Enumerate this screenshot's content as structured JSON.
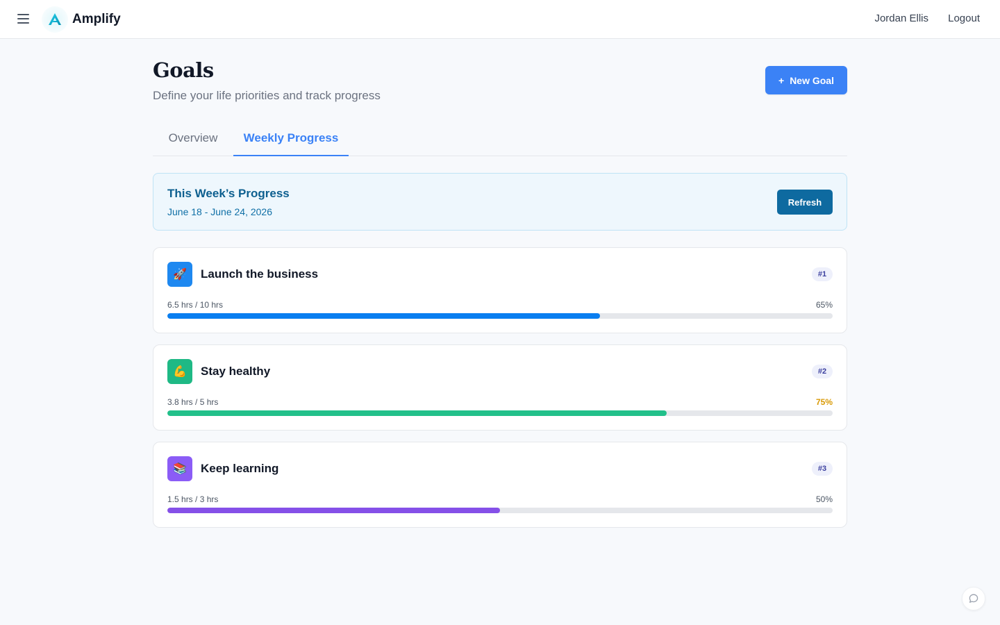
{
  "app": {
    "brand_name": "Amplify",
    "user_name": "Jordan Ellis",
    "logout_label": "Logout"
  },
  "header": {
    "title": "Goals",
    "subtitle": "Define your life priorities and track progress",
    "new_goal_label": "New Goal",
    "new_goal_icon": "+"
  },
  "tabs": [
    {
      "label": "Overview",
      "active": false
    },
    {
      "label": "Weekly Progress",
      "active": true
    }
  ],
  "week": {
    "title": "This Week’s Progress",
    "dates": "June 18 - June 24, 2026",
    "refresh_label": "Refresh"
  },
  "goals": [
    {
      "name": "Launch the business",
      "icon": "rocket-icon",
      "icon_glyph": "🚀",
      "icon_bg": "#1e88f0",
      "rank": "#1",
      "hours": "6.5 hrs / 10 hrs",
      "percent_label": "65%",
      "progress": 0.65,
      "bar_color": "#0a7ef0",
      "percent_color": "#4b5563"
    },
    {
      "name": "Stay healthy",
      "icon": "flexed-biceps-icon",
      "icon_glyph": "💪",
      "icon_bg": "#1fb985",
      "rank": "#2",
      "hours": "3.8 hrs / 5 hrs",
      "percent_label": "75%",
      "progress": 0.75,
      "bar_color": "#22c08a",
      "percent_color": "#d99a06"
    },
    {
      "name": "Keep learning",
      "icon": "books-icon",
      "icon_glyph": "📚",
      "icon_bg": "#8b5cf6",
      "rank": "#3",
      "hours": "1.5 hrs / 3 hrs",
      "percent_label": "50%",
      "progress": 0.5,
      "bar_color": "#8550e8",
      "percent_color": "#4b5563"
    }
  ],
  "colors": {
    "accent": "#3b82f6",
    "refresh_button": "#0e6aa0",
    "week_card_bg": "#eef7fd"
  }
}
